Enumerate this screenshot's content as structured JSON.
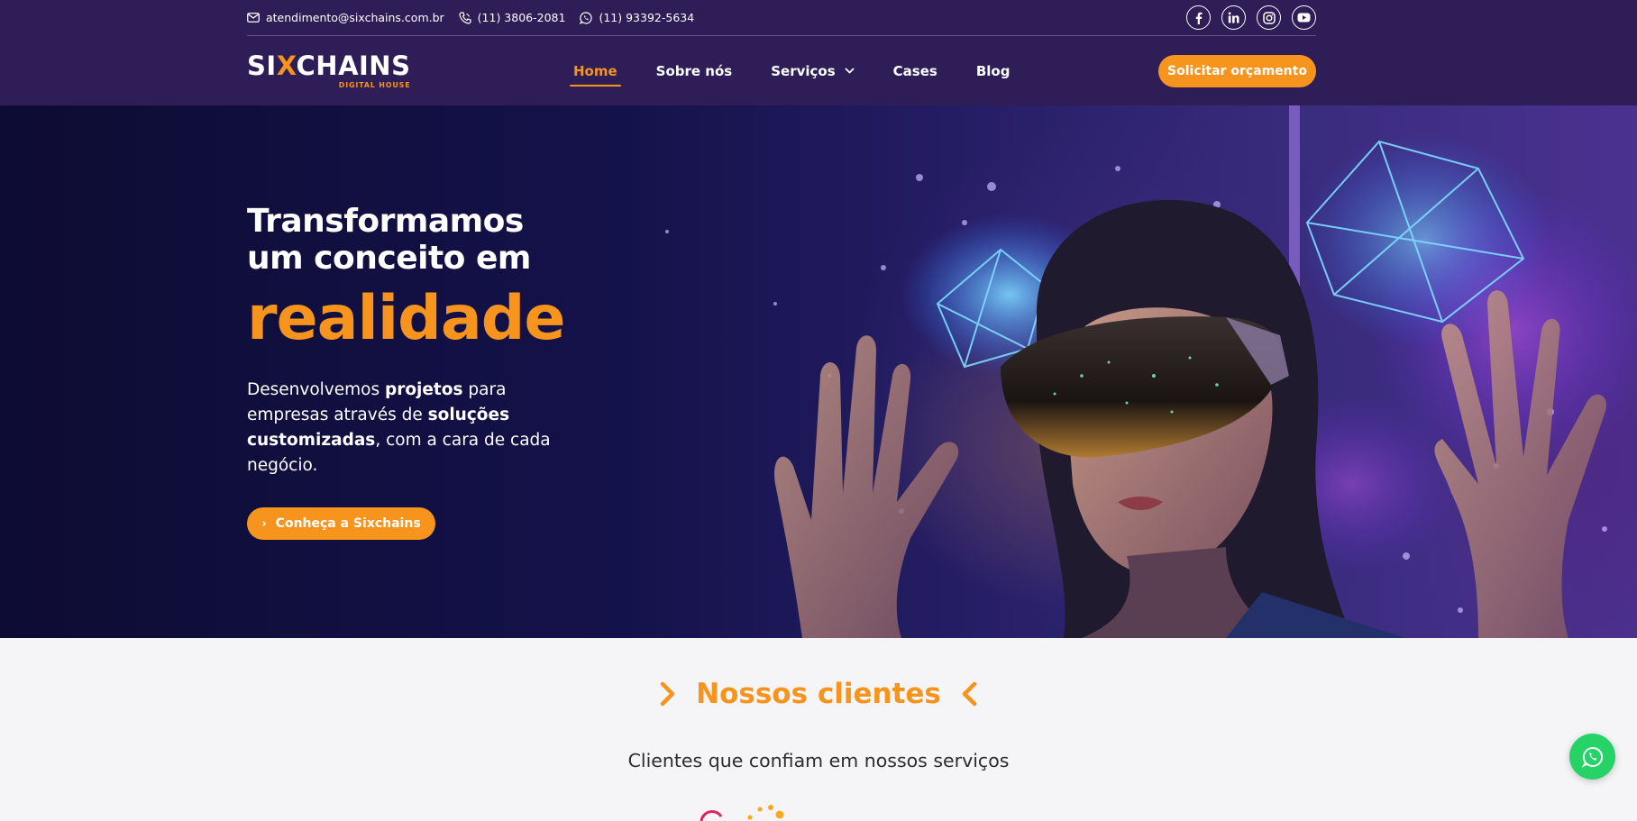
{
  "topbar": {
    "email": "atendimento@sixchains.com.br",
    "phone": "(11) 3806-2081",
    "whatsapp": "(11) 93392-5634",
    "socials": [
      "facebook-icon",
      "linkedin-icon",
      "instagram-icon",
      "youtube-icon"
    ]
  },
  "logo": {
    "main_pre": "SI",
    "main_x": "X",
    "main_post": "CHAINS",
    "sub": "DIGITAL HOUSE"
  },
  "nav": {
    "items": [
      "Home",
      "Sobre nós",
      "Serviços",
      "Cases",
      "Blog"
    ],
    "active": "Home",
    "cta": "Solicitar orçamento"
  },
  "hero": {
    "line1": "Transformamos",
    "line2": "um conceito em",
    "accent": "realidade",
    "desc_part1": "Desenvolvemos ",
    "desc_bold1": "projetos",
    "desc_part2": " para empresas através de ",
    "desc_bold2": "soluções customizadas",
    "desc_part3": ", com a cara de cada negócio.",
    "button": "Conheça a Sixchains"
  },
  "clients": {
    "title": "Nossos clientes",
    "subtitle": "Clientes que confiam em nossos serviços"
  },
  "colors": {
    "brand_purple": "#2e1d56",
    "accent_orange": "#f7941d",
    "whatsapp_green": "#25d366"
  }
}
